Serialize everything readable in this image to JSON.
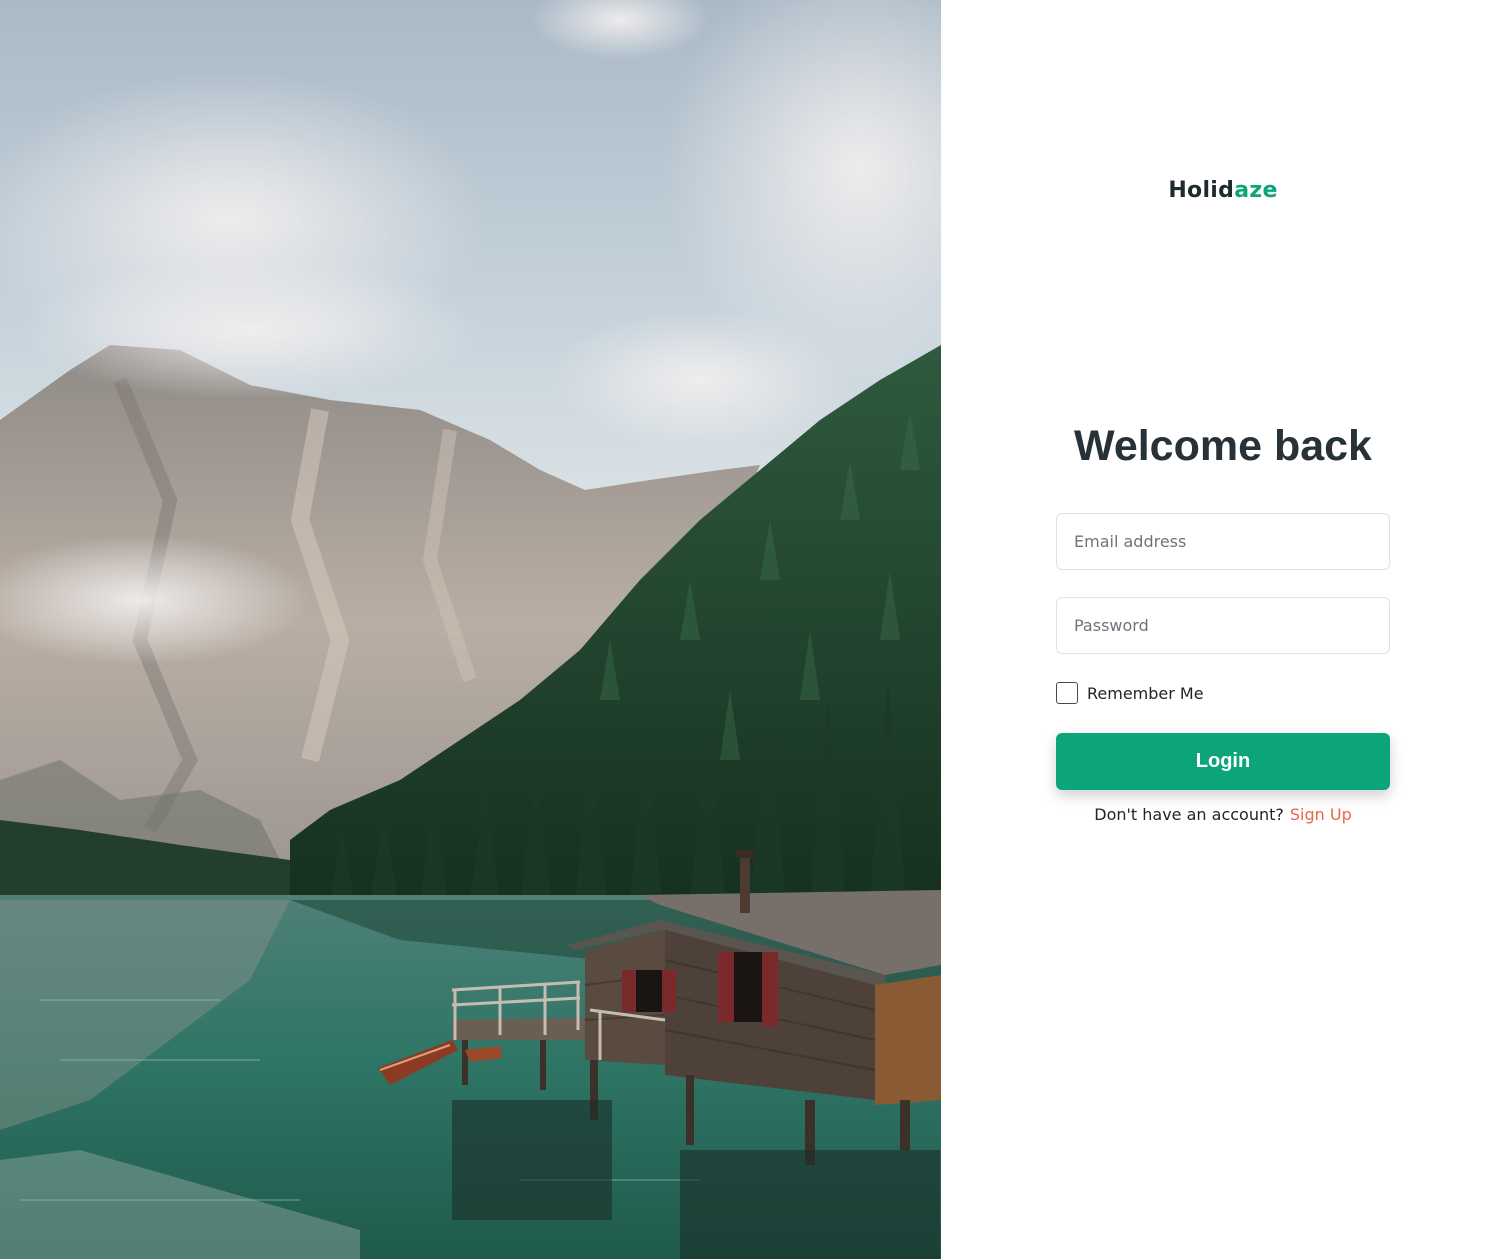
{
  "brand": {
    "part1": "Holid",
    "part2": "aze"
  },
  "login": {
    "title": "Welcome back",
    "email_placeholder": "Email address",
    "password_placeholder": "Password",
    "remember_label": "Remember Me",
    "submit_label": "Login",
    "signup_prompt": "Don't have an account?",
    "signup_link": "Sign Up"
  },
  "colors": {
    "accent": "#0ca47a",
    "link": "#e8674a",
    "heading": "#263238"
  }
}
